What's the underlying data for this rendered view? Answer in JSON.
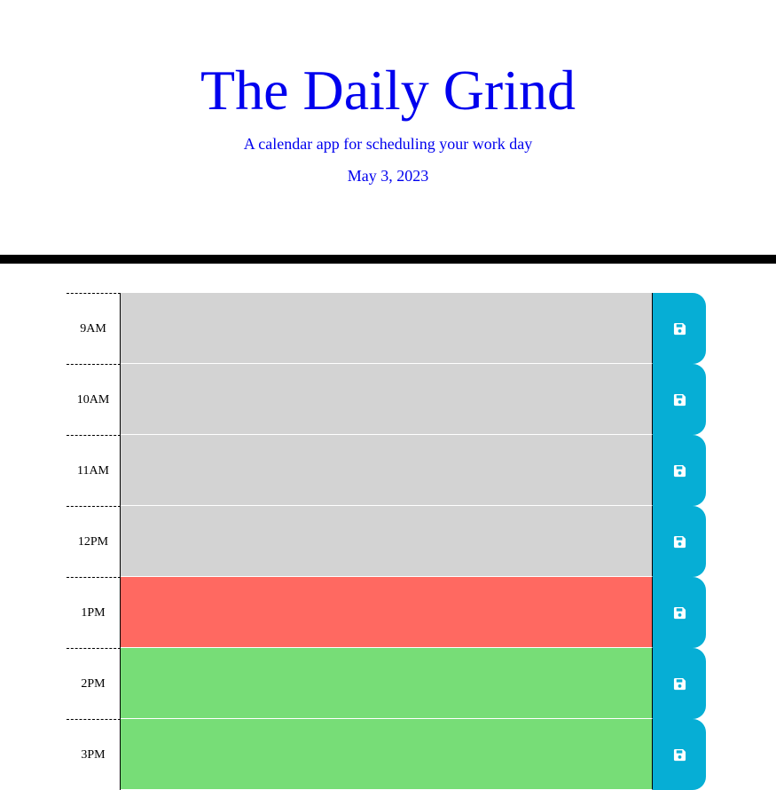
{
  "header": {
    "title": "The Daily Grind",
    "subtitle": "A calendar app for scheduling your work day",
    "date": "May 3, 2023"
  },
  "colors": {
    "title_text": "#0000ee",
    "past": "#d3d3d3",
    "present": "#ff6961",
    "future": "#77dd77",
    "save_button": "#06aed5",
    "save_icon": "#ffffff"
  },
  "save_icon_name": "floppy-disk-icon",
  "schedule": {
    "rows": [
      {
        "hour": "9AM",
        "status": "past",
        "text": ""
      },
      {
        "hour": "10AM",
        "status": "past",
        "text": ""
      },
      {
        "hour": "11AM",
        "status": "past",
        "text": ""
      },
      {
        "hour": "12PM",
        "status": "past",
        "text": ""
      },
      {
        "hour": "1PM",
        "status": "present",
        "text": ""
      },
      {
        "hour": "2PM",
        "status": "future",
        "text": ""
      },
      {
        "hour": "3PM",
        "status": "future",
        "text": ""
      }
    ]
  }
}
